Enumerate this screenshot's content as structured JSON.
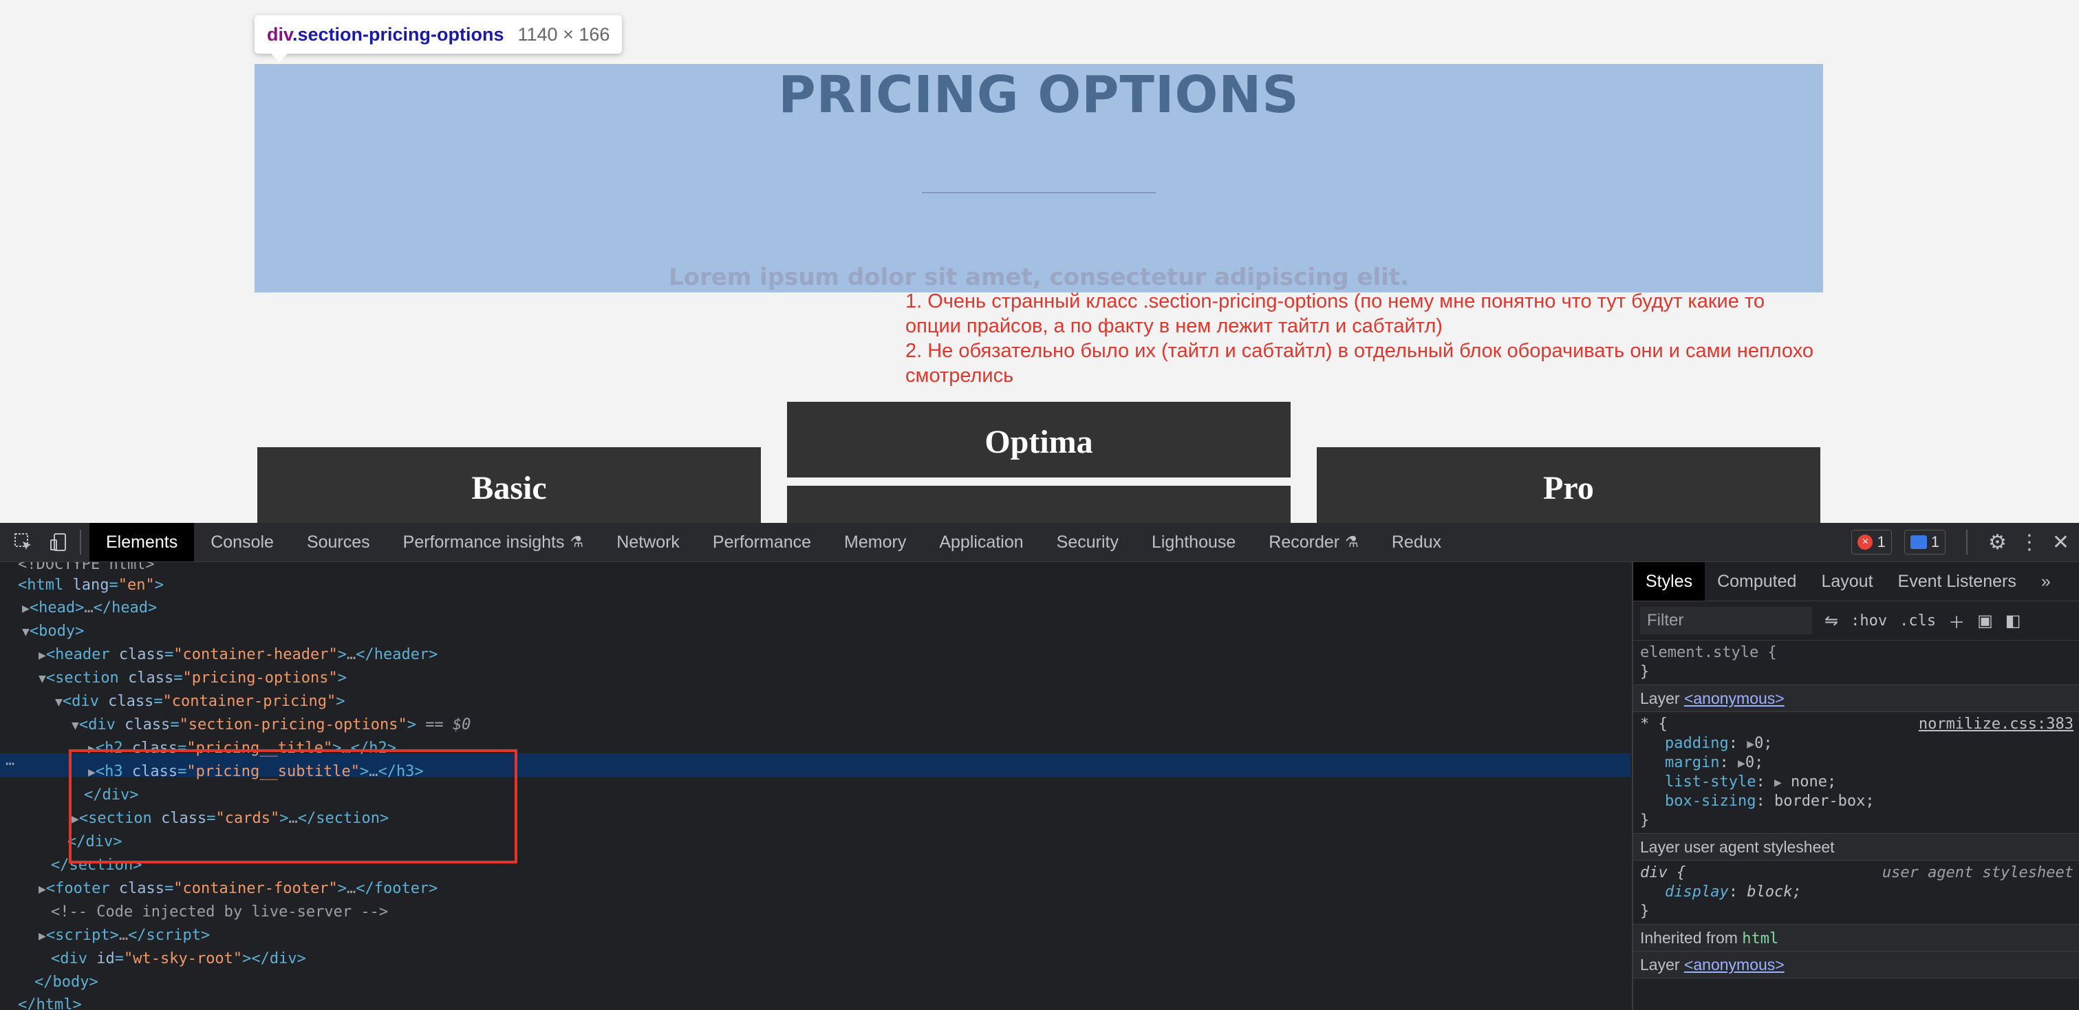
{
  "page": {
    "tooltip": {
      "tag": "div",
      "class": ".section-pricing-options",
      "size": "1140 × 166"
    },
    "title": "PRICING OPTIONS",
    "subtitle": "Lorem ipsum dolor sit amet, consectetur adipiscing elit.",
    "comment_line1": "1. Очень странный класс .section-pricing-options (по нему мне понятно что тут будут какие то опции прайсов, а по факту в нем лежит тайтл и сабтайтл)",
    "comment_line2": "2. Не обязательно было их (тайтл и сабтайтл) в отдельный блок оборачивать они и сами неплохо смотрелись",
    "cards": [
      "Basic",
      "Optima",
      "Pro"
    ],
    "colors": {
      "highlight": "#a3bfe1",
      "comment": "#e0362c",
      "card_bg": "#333333"
    }
  },
  "devtools": {
    "tabs": [
      "Elements",
      "Console",
      "Sources",
      "Performance insights",
      "Network",
      "Performance",
      "Memory",
      "Application",
      "Security",
      "Lighthouse",
      "Recorder",
      "Redux"
    ],
    "errors_count": "1",
    "messages_count": "1",
    "dom": {
      "doctype": "<!DOCTYPE html>",
      "selected_suffix": "== $0"
    },
    "styles": {
      "tabs": [
        "Styles",
        "Computed",
        "Layout",
        "Event Listeners"
      ],
      "filter_placeholder": "Filter",
      "hov": ":hov",
      "cls": ".cls",
      "element_style": "element.style {",
      "close_brace": "}",
      "layer_label": "Layer",
      "layer_anon": "<anonymous>",
      "rule1_selector": "* {",
      "rule1_source": "normilize.css:383",
      "rule1_props": [
        {
          "name": "padding",
          "value": "0;"
        },
        {
          "name": "margin",
          "value": "0;"
        },
        {
          "name": "list-style",
          "value": "none;"
        },
        {
          "name": "box-sizing",
          "value": "border-box;"
        }
      ],
      "ua_layer": "Layer user agent stylesheet",
      "ua_selector": "div {",
      "ua_source": "user agent stylesheet",
      "ua_prop": {
        "name": "display",
        "value": "block;"
      },
      "inherited_from": "Inherited from",
      "inherited_tag": "html"
    }
  }
}
